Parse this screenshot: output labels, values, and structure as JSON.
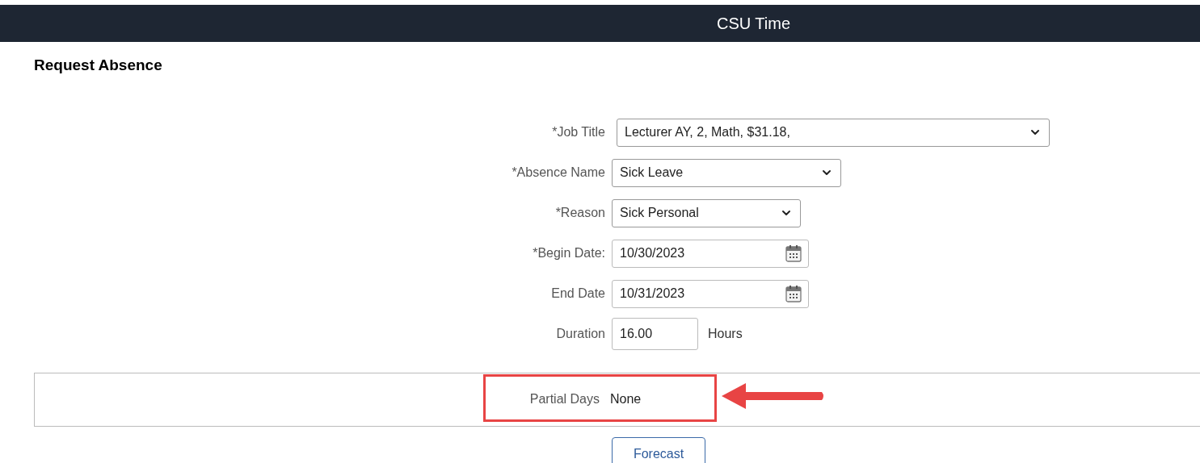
{
  "header": {
    "title": "CSU Time"
  },
  "page_title": "Request Absence",
  "fields": [
    {
      "kind": "select",
      "label": "*Job Title",
      "value": "Lecturer AY, 2, Math, $31.18,"
    },
    {
      "kind": "select",
      "label": "*Absence Name",
      "value": "Sick Leave"
    },
    {
      "kind": "select",
      "label": "*Reason",
      "value": "Sick Personal"
    },
    {
      "kind": "date",
      "label": "*Begin Date:",
      "value": "10/30/2023"
    },
    {
      "kind": "date",
      "label": "End Date",
      "value": "10/31/2023"
    },
    {
      "kind": "number",
      "label": "Duration",
      "value": "16.00",
      "unit": "Hours"
    }
  ],
  "partial_days": {
    "label": "Partial Days",
    "value": "None",
    "highlighted": true
  },
  "buttons": [
    "Forecast"
  ]
}
